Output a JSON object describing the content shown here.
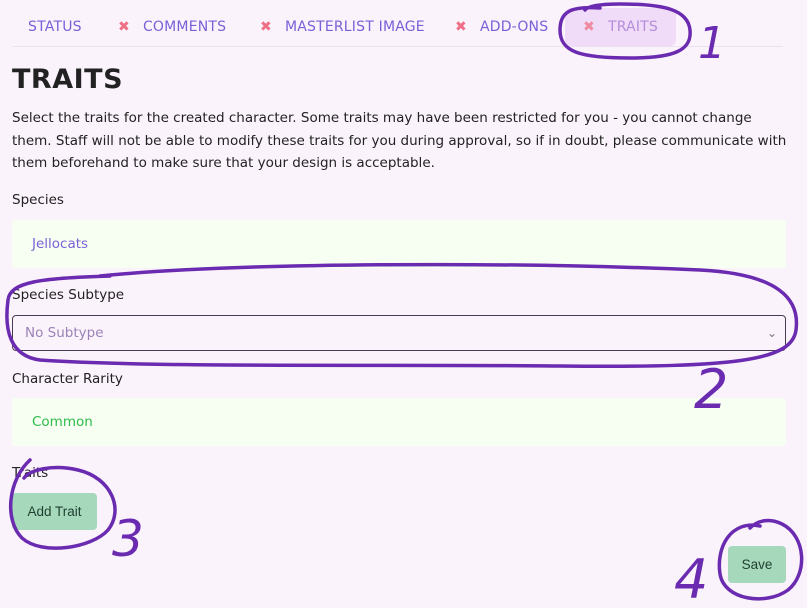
{
  "tabs": [
    {
      "label": "STATUS"
    },
    {
      "label": "COMMENTS",
      "x_icon": "✖"
    },
    {
      "label": "MASTERLIST IMAGE",
      "x_icon": "✖"
    },
    {
      "label": "ADD-ONS",
      "x_icon": "✖"
    },
    {
      "label": "TRAITS",
      "x_icon": "✖",
      "active": true
    }
  ],
  "page": {
    "title": "TRAITS",
    "intro": "Select the traits for the created character. Some traits may have been restricted for you - you cannot change them. Staff will not be able to modify these traits for you during approval, so if in doubt, please communicate with them beforehand to make sure that your design is acceptable."
  },
  "species": {
    "label": "Species",
    "value": "Jellocats"
  },
  "subtype": {
    "label": "Species Subtype",
    "value": "No Subtype"
  },
  "rarity": {
    "label": "Character Rarity",
    "value": "Common"
  },
  "traits": {
    "label": "Traits",
    "add_button": "Add Trait"
  },
  "save_button": "Save",
  "colors": {
    "tab_text": "#7a60d6",
    "tab_close": "#ef6f86",
    "active_tab_bg": "#f0dcf8",
    "species_value": "#7a60d6",
    "rarity_value": "#2dbb4a",
    "button_bg": "#a6d8bc",
    "annotation": "#6a2bb0"
  },
  "annotations": {
    "n1": "1",
    "n2": "2",
    "n3": "3",
    "n4": "4"
  }
}
